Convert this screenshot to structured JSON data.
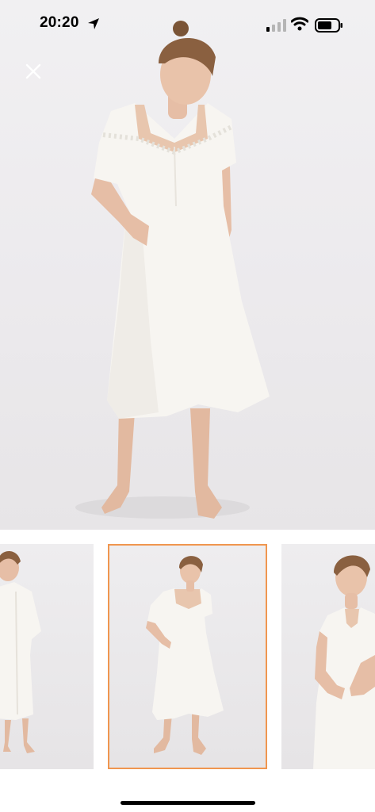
{
  "status_bar": {
    "time": "20:20",
    "icons": [
      "location-arrow-icon",
      "cellular-signal-icon",
      "wifi-icon",
      "battery-icon"
    ]
  },
  "gallery": {
    "close_icon": "close-icon",
    "thumbnails": [
      {
        "name": "thumbnail-1",
        "selected": false
      },
      {
        "name": "thumbnail-2",
        "selected": true
      },
      {
        "name": "thumbnail-3",
        "selected": false
      }
    ],
    "selected_border_color": "#f0964f"
  },
  "colors": {
    "background": "#ffffff",
    "photo_background": "#eceaed",
    "garment": "#f7f5f1"
  }
}
